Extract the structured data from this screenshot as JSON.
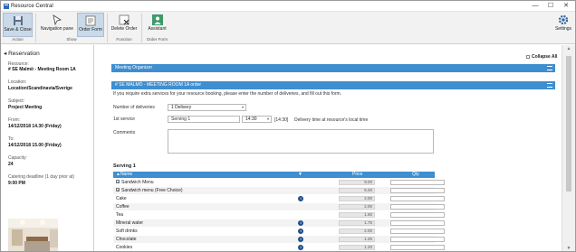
{
  "window": {
    "title": "Resource Central",
    "minimize": "—",
    "maximize": "☐",
    "close": "✕"
  },
  "ribbon": {
    "buttons": [
      {
        "label": "Save & Close",
        "icon": "save-icon"
      },
      {
        "label": "Navigation pane",
        "icon": "navigation-icon"
      },
      {
        "label": "Order Form",
        "icon": "order-form-icon"
      },
      {
        "label": "Delete Order",
        "icon": "delete-order-icon"
      },
      {
        "label": "Assistant",
        "icon": "assistant-icon"
      },
      {
        "label": "Settings",
        "icon": "gear-icon"
      }
    ],
    "groups": [
      "Action",
      "Show",
      "Function",
      "Order Form"
    ]
  },
  "sidebar": {
    "heading": "Reservation",
    "fields": [
      {
        "label": "Resource:",
        "value": "# SE Malmö - Meeting Room 1A"
      },
      {
        "label": "Location:",
        "value": "Location/Scandinavia/Sverige"
      },
      {
        "label": "Subject:",
        "value": "Project Meeting"
      },
      {
        "label": "From:",
        "value": "14/12/2018 14.30 (Friday)"
      },
      {
        "label": "To:",
        "value": "14/12/2018 15.00 (Friday)"
      },
      {
        "label": "Capacity:",
        "value": "24"
      },
      {
        "label": "Catering deadline (1 day prior at)",
        "value": "9:00 PM"
      }
    ]
  },
  "main": {
    "collapse_all": "Collapse All",
    "meeting_organizer": "Meeting Organizer",
    "room_order": "# SE MALMÖ - MEETING ROOM 1A order",
    "info": "If you require extra services for your resource booking, please enter the number of deliveries, and fill out this form.",
    "number_of_deliveries": {
      "label": "Number of deliveries",
      "value": "1 Delivery"
    },
    "first_service": {
      "label": "1st service",
      "value": "Serving 1",
      "time": "14:30",
      "time_bracket": "[14:30]",
      "hint": "Delivery time at resource's local time"
    },
    "comments": {
      "label": "Comments"
    },
    "serving_title": "Serving 1",
    "grid": {
      "headers": {
        "name": "▲Name",
        "price": "Price",
        "qty": "Qty"
      },
      "rows": [
        {
          "name": "Sandwich Menu",
          "expand": "+",
          "price": "9.00",
          "info": ""
        },
        {
          "name": "Sandwich menu (Free Choice)",
          "expand": "+",
          "price": "5.00",
          "info": ""
        },
        {
          "name": "Cake",
          "expand": "",
          "price": "2.00",
          "info": "i"
        },
        {
          "name": "Coffee",
          "expand": "",
          "price": "2.00",
          "info": ""
        },
        {
          "name": "Tea",
          "expand": "",
          "price": "1.50",
          "info": ""
        },
        {
          "name": "Mineral water",
          "expand": "",
          "price": "1.75",
          "info": "i"
        },
        {
          "name": "Soft drinks",
          "expand": "",
          "price": "2.00",
          "info": "i"
        },
        {
          "name": "Chocolate",
          "expand": "",
          "price": "1.25",
          "info": "i"
        },
        {
          "name": "Cookies",
          "expand": "",
          "price": "1.20",
          "info": "i"
        }
      ]
    }
  }
}
